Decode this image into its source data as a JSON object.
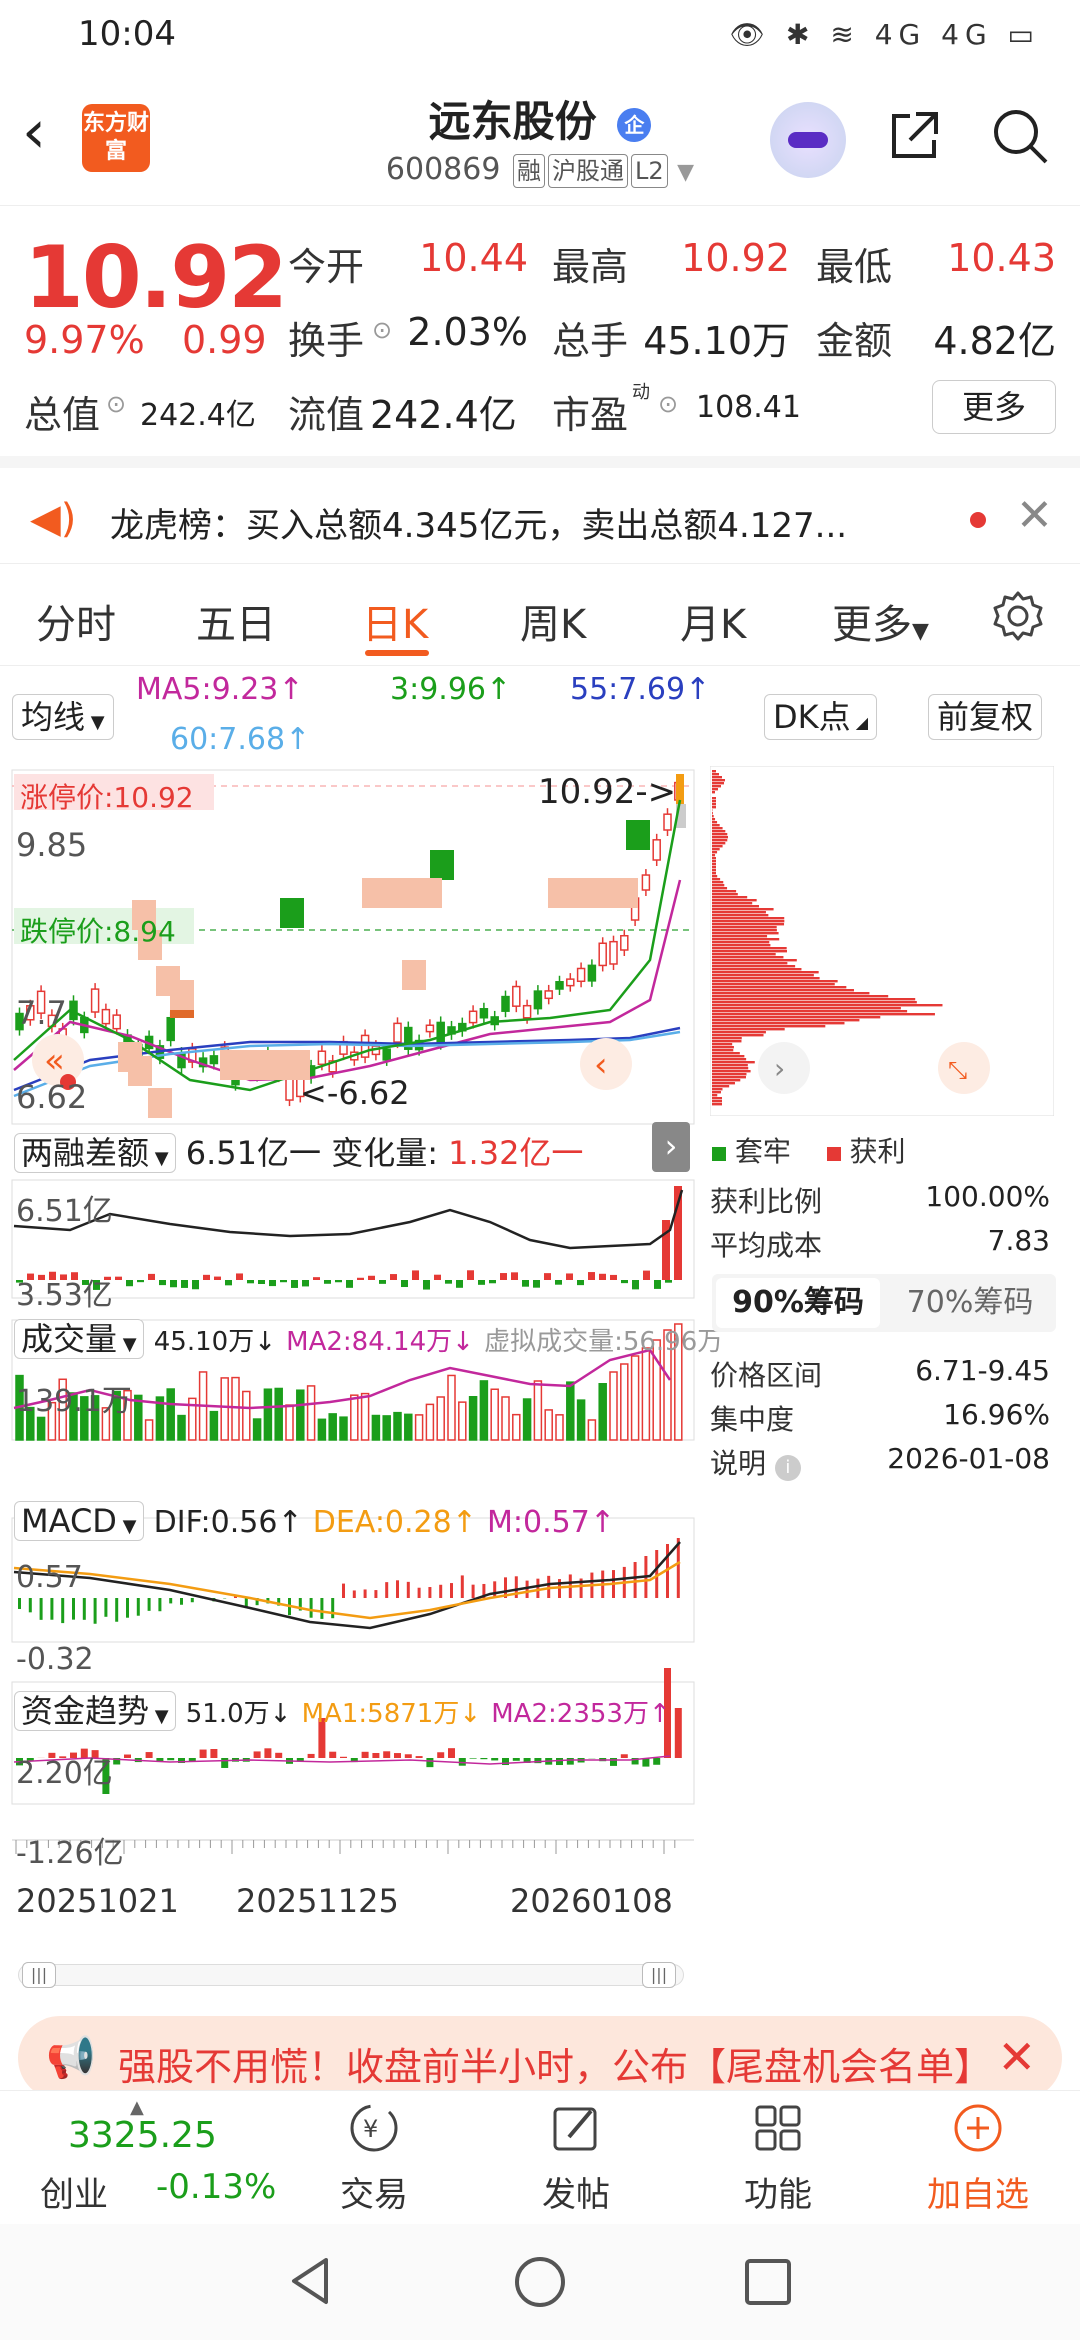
{
  "status": {
    "time": "10:04",
    "icons": "👁 ✱ ≋ 4G 4G ▭"
  },
  "header": {
    "title": "远东股份",
    "title_badge": "企",
    "code": "600869",
    "tags": [
      "融",
      "沪股通",
      "L2"
    ],
    "logo_text": "东方财富"
  },
  "quote": {
    "price": "10.92",
    "pct": "9.97%",
    "change": "0.99",
    "open_label": "今开",
    "open": "10.44",
    "high_label": "最高",
    "high": "10.92",
    "low_label": "最低",
    "low": "10.43",
    "turnover_label": "换手",
    "turnover": "2.03%",
    "volume_label": "总手",
    "volume": "45.10万",
    "amount_label": "金额",
    "amount": "4.82亿",
    "mcap_label": "总值",
    "mcap": "242.4亿",
    "float_label": "流值",
    "float": "242.4亿",
    "pe_label": "市盈",
    "pe_sup": "动",
    "pe": "108.41",
    "more": "更多"
  },
  "news": {
    "text": "龙虎榜：买入总额4.345亿元，卖出总额4.127..."
  },
  "tabs": [
    "分时",
    "五日",
    "日K",
    "周K",
    "月K",
    "更多"
  ],
  "active_tab": "日K",
  "toolbar": {
    "ma_dropdown": "均线",
    "ma5": "MA5:9.23↑",
    "ma3": "3:9.96↑",
    "ma55": "55:7.69↑",
    "ma60": "60:7.68↑",
    "dk_button": "DK点",
    "adj_button": "前复权"
  },
  "kline": {
    "limit_up": "涨停价:10.92",
    "limit_down": "跌停价:8.94",
    "right_arrow": "10.92->",
    "low_marker": "<-6.62",
    "axis": [
      "9.85",
      "7.7",
      "6.62"
    ]
  },
  "margin": {
    "label": "两融差额",
    "value": "6.51亿一",
    "chg_label": "变化量:",
    "chg": "1.32亿一",
    "axis": [
      "6.51亿",
      "3.53亿"
    ]
  },
  "volume": {
    "label": "成交量",
    "value": "45.10万↓",
    "ma2": "MA2:84.14万↓",
    "virtual": "虚拟成交量:56.96万",
    "axis": [
      "139.1万"
    ]
  },
  "macd": {
    "label": "MACD",
    "dif": "DIF:0.56↑",
    "dea": "DEA:0.28↑",
    "m": "M:0.57↑",
    "axis": [
      "0.57",
      "-0.32"
    ]
  },
  "flow": {
    "label": "资金趋势",
    "value": "51.0万↓",
    "ma1": "MA1:5871万↓",
    "ma2": "MA2:2353万↑",
    "axis": [
      "2.20亿",
      "-1.26亿"
    ]
  },
  "dates": [
    "20251021",
    "20251125",
    "20260108"
  ],
  "chips": {
    "legend_trap": "套牢",
    "legend_profit": "获利",
    "profit_ratio_label": "获利比例",
    "profit_ratio": "100.00%",
    "avg_cost_label": "平均成本",
    "avg_cost": "7.83",
    "tab90": "90%筹码",
    "tab70": "70%筹码",
    "range_label": "价格区间",
    "range": "6.71-9.45",
    "conc_label": "集中度",
    "conc": "16.96%",
    "note_label": "说明",
    "note": "2026-01-08"
  },
  "promo": {
    "text": "强股不用慌！收盘前半小时，公布【尾盘机会名单】"
  },
  "bottom": {
    "index_value": "3325.25",
    "index_name": "创业",
    "index_pct": "-0.13%",
    "trade": "交易",
    "post": "发帖",
    "func": "功能",
    "add": "加自选"
  },
  "colors": {
    "up": "#e53935",
    "down": "#1b9e1b",
    "accent": "#f25b1f"
  }
}
